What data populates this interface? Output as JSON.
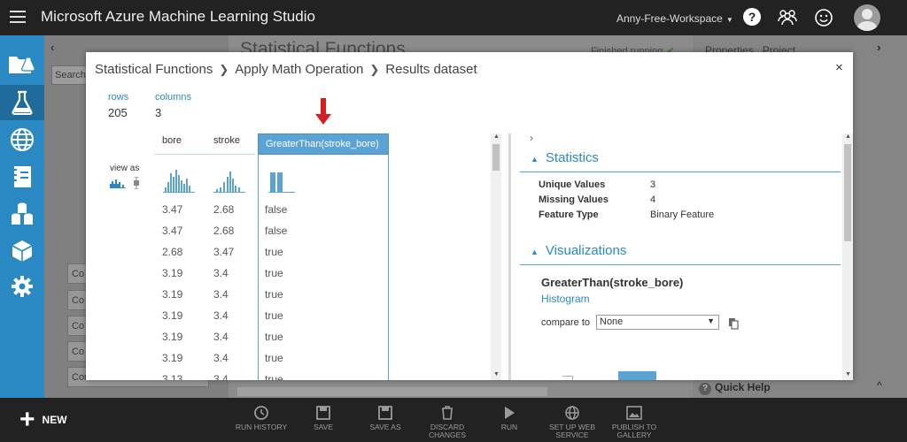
{
  "app": {
    "title": "Microsoft Azure Machine Learning Studio",
    "workspace": "Anny-Free-Workspace",
    "help_glyph": "?"
  },
  "background": {
    "canvas_title": "Statistical Functions",
    "status": "Finished running",
    "tabs": [
      "Properties",
      "Project"
    ],
    "search_placeholder": "Search",
    "palette_items": [
      "Co",
      "Co",
      "Co",
      "Co",
      "Convert to TSV"
    ],
    "quick_help": "Quick Help"
  },
  "modal": {
    "breadcrumb": [
      "Statistical Functions",
      "Apply Math Operation",
      "Results dataset"
    ],
    "rows_label": "rows",
    "rows_value": "205",
    "columns_label": "columns",
    "columns_value": "3",
    "view_as_label": "view as",
    "columns": [
      "bore",
      "stroke",
      "GreaterThan(stroke_bore)"
    ],
    "rows": [
      [
        "3.47",
        "2.68",
        "false"
      ],
      [
        "3.47",
        "2.68",
        "false"
      ],
      [
        "2.68",
        "3.47",
        "true"
      ],
      [
        "3.19",
        "3.4",
        "true"
      ],
      [
        "3.19",
        "3.4",
        "true"
      ],
      [
        "3.19",
        "3.4",
        "true"
      ],
      [
        "3.19",
        "3.4",
        "true"
      ],
      [
        "3.19",
        "3.4",
        "true"
      ],
      [
        "3.13",
        "3.4",
        "true"
      ]
    ],
    "statistics": {
      "heading": "Statistics",
      "items": [
        {
          "key": "Unique Values",
          "value": "3"
        },
        {
          "key": "Missing Values",
          "value": "4"
        },
        {
          "key": "Feature Type",
          "value": "Binary Feature"
        }
      ]
    },
    "visualizations": {
      "heading": "Visualizations",
      "title": "GreaterThan(stroke_bore)",
      "subtitle": "Histogram",
      "compare_label": "compare to",
      "compare_value": "None"
    }
  },
  "toolbar": {
    "new_label": "NEW",
    "tools": [
      "RUN HISTORY",
      "SAVE",
      "SAVE AS",
      "DISCARD CHANGES",
      "RUN",
      "SET UP WEB SERVICE",
      "PUBLISH TO GALLERY"
    ]
  },
  "colors": {
    "accent": "#2a89c2",
    "header_highlight": "#5aa3d4",
    "topbar": "#222222"
  }
}
